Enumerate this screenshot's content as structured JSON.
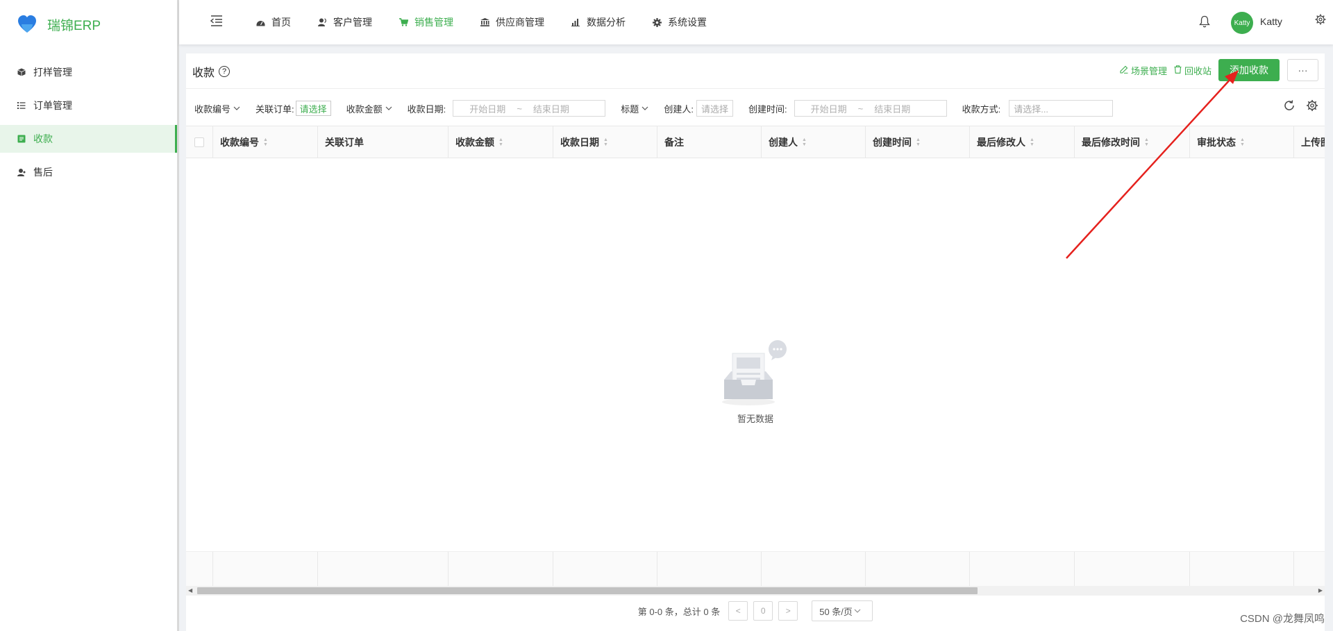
{
  "app": {
    "title": "瑞锦ERP"
  },
  "colors": {
    "accent": "#3dae4f",
    "annotation_arrow": "#e5211d",
    "logo_heart": "#2a7de1"
  },
  "sidebar": {
    "items": [
      {
        "label": "打样管理",
        "icon": "cube-icon"
      },
      {
        "label": "订单管理",
        "icon": "list-icon"
      },
      {
        "label": "收款",
        "icon": "receipt-icon",
        "active": true
      },
      {
        "label": "售后",
        "icon": "user-service-icon"
      }
    ]
  },
  "header": {
    "nav": [
      {
        "label": "首页",
        "icon": "dashboard-icon"
      },
      {
        "label": "客户管理",
        "icon": "customer-icon"
      },
      {
        "label": "销售管理",
        "icon": "cart-icon",
        "active": true
      },
      {
        "label": "供应商管理",
        "icon": "bank-icon"
      },
      {
        "label": "数据分析",
        "icon": "bar-chart-icon"
      },
      {
        "label": "系统设置",
        "icon": "gear-icon"
      }
    ],
    "user": {
      "avatar_text": "Katty",
      "name": "Katty"
    }
  },
  "page": {
    "title": "收款",
    "actions": {
      "scene": "场景管理",
      "recycle": "回收站",
      "add": "添加收款",
      "more": "···"
    }
  },
  "filters": {
    "receipt_no": "收款编号",
    "related_order": "关联订单:",
    "related_order_value": "请选择",
    "amount": "收款金额",
    "date": "收款日期:",
    "date_start_ph": "开始日期",
    "date_sep": "~",
    "date_end_ph": "结束日期",
    "title": "标题",
    "creator": "创建人:",
    "creator_value": "请选择",
    "created_time": "创建时间:",
    "created_start_ph": "开始日期",
    "created_sep": "~",
    "created_end_ph": "结束日期",
    "method": "收款方式:",
    "method_ph": "请选择..."
  },
  "table": {
    "columns": [
      "收款编号",
      "关联订单",
      "收款金额",
      "收款日期",
      "备注",
      "创建人",
      "创建时间",
      "最后修改人",
      "最后修改时间",
      "审批状态",
      "上传图片"
    ],
    "sortable": [
      true,
      false,
      true,
      true,
      false,
      true,
      true,
      true,
      true,
      true,
      false
    ],
    "empty_text": "暂无数据"
  },
  "pagination": {
    "summary": "第 0-0 条，总计 0 条",
    "prev": "<",
    "page": "0",
    "next": ">",
    "page_size": "50 条/页"
  },
  "watermark": "CSDN @龙舞凤鸣"
}
